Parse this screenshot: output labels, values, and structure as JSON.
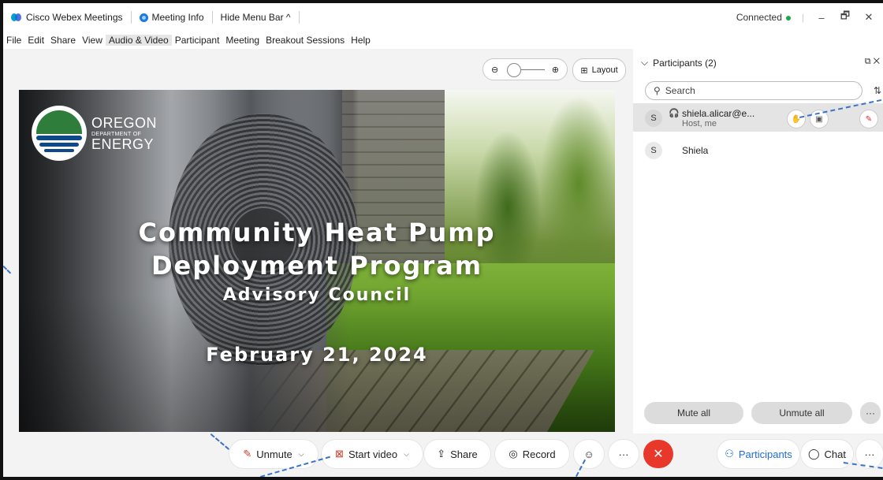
{
  "titlebar": {
    "app_name": "Cisco Webex Meetings",
    "meeting_info": "Meeting Info",
    "hide_menu_bar": "Hide Menu Bar ^",
    "status": "Connected",
    "minimize": "–",
    "restore": "🗗",
    "close": "✕"
  },
  "menu": {
    "items": [
      "File",
      "Edit",
      "Share",
      "View",
      "Audio & Video",
      "Participant",
      "Meeting",
      "Breakout Sessions",
      "Help"
    ],
    "active_index": 4
  },
  "stage": {
    "zoom_out_icon": "⊖",
    "zoom_in_icon": "⊕",
    "layout_label": "Layout"
  },
  "slide": {
    "logo_line1": "OREGON",
    "logo_line2": "DEPARTMENT OF",
    "logo_line3": "ENERGY",
    "title_line1": "Community Heat Pump",
    "title_line2": "Deployment Program",
    "title_line3": "Advisory Council",
    "date": "February 21, 2024"
  },
  "participants_panel": {
    "title": "Participants (2)",
    "search_placeholder": "Search",
    "participants": [
      {
        "initial": "S",
        "name": "shiela.alicar@e...",
        "subtitle": "Host, me"
      },
      {
        "initial": "S",
        "name": "Shiela",
        "subtitle": ""
      }
    ],
    "mute_all": "Mute all",
    "unmute_all": "Unmute all",
    "more": "···"
  },
  "controls": {
    "unmute": "Unmute",
    "start_video": "Start video",
    "share": "Share",
    "record": "Record",
    "more": "···",
    "participants": "Participants",
    "chat": "Chat",
    "chat_more": "···"
  },
  "colors": {
    "leave_red": "#e8382c",
    "accent_blue": "#1f6bd1",
    "connected_green": "#1aa84a"
  }
}
